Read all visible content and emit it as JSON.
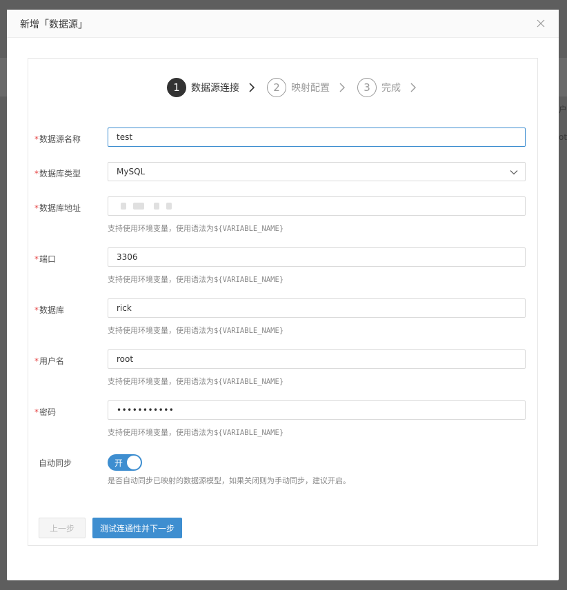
{
  "dialog": {
    "title": "新增「数据源」",
    "close_label": "×"
  },
  "background": {
    "fragment_1": "户",
    "fragment_2": "ot"
  },
  "steps": [
    {
      "number": "1",
      "label": "数据源连接",
      "active": true
    },
    {
      "number": "2",
      "label": "映射配置",
      "active": false
    },
    {
      "number": "3",
      "label": "完成",
      "active": false
    }
  ],
  "form": {
    "hint_prefix": "支持使用环境变量，使用语法为",
    "hint_var": "${VARIABLE_NAME}",
    "name": {
      "label": "数据源名称",
      "value": "test"
    },
    "db_type": {
      "label": "数据库类型",
      "value": "MySQL"
    },
    "address": {
      "label": "数据库地址",
      "value": ""
    },
    "port": {
      "label": "端口",
      "value": "3306"
    },
    "database": {
      "label": "数据库",
      "value": "rick"
    },
    "username": {
      "label": "用户名",
      "value": "root"
    },
    "password": {
      "label": "密码",
      "value": "•••••••••••"
    },
    "auto_sync": {
      "label": "自动同步",
      "toggle_text": "开",
      "on": true,
      "hint": "是否自动同步已映射的数据源模型，如果关闭则为手动同步，建议开启。"
    }
  },
  "buttons": {
    "prev": "上一步",
    "next": "测试连通性并下一步"
  },
  "colors": {
    "primary": "#3e8ed0",
    "required": "#e54545",
    "step_active": "#333333",
    "overlay": "#5e5e5e"
  }
}
